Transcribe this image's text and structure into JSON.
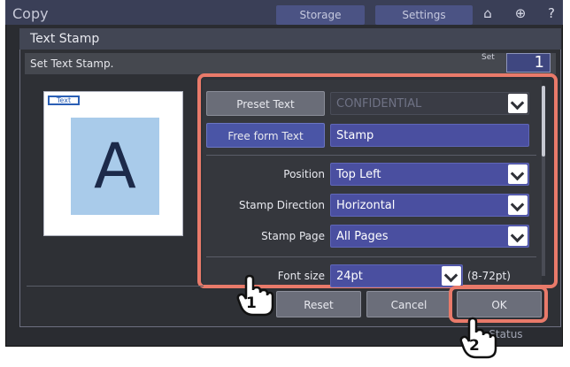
{
  "top_bar": {
    "app_title": "Copy",
    "storage_label": "Storage",
    "settings_label": "Settings",
    "icons": [
      "home-icon",
      "globe-icon",
      "help-icon"
    ]
  },
  "dialog": {
    "title": "Text Stamp",
    "instruction": "Set Text Stamp.",
    "set_label": "Set",
    "set_value": "1"
  },
  "preview": {
    "tag": "Text",
    "letter": "A"
  },
  "options": {
    "preset_text_button": "Preset Text",
    "preset_text_value": "CONFIDENTIAL",
    "free_form_button": "Free form Text",
    "free_form_value": "Stamp",
    "position_label": "Position",
    "position_value": "Top Left",
    "direction_label": "Stamp Direction",
    "direction_value": "Horizontal",
    "page_label": "Stamp Page",
    "page_value": "All Pages",
    "font_size_label": "Font size",
    "font_size_value": "24pt",
    "font_size_range": "(8-72pt)"
  },
  "buttons": {
    "reset": "Reset",
    "cancel": "Cancel",
    "ok": "OK"
  },
  "footer": {
    "job_status": "Job Status"
  },
  "callouts": {
    "step1": "1",
    "step2": "2"
  },
  "colors": {
    "highlight": "#e97a6a",
    "accent_blue": "#4a4fa0"
  }
}
